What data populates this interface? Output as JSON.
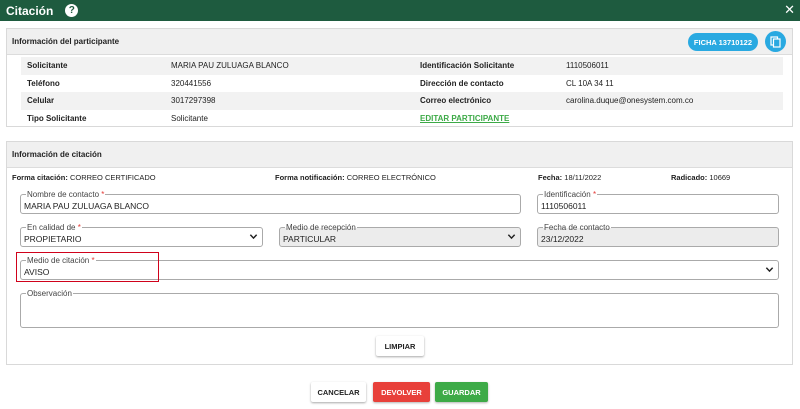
{
  "window": {
    "title": "Citación",
    "help_icon": "?",
    "close_icon": "✕"
  },
  "participant": {
    "header": "Información del participante",
    "ficha_label": "FICHA 13710122",
    "rows": [
      {
        "label1": "Solicitante",
        "value1": "MARIA PAU ZULUAGA BLANCO",
        "label2": "Identificación Solicitante",
        "value2": "1110506011"
      },
      {
        "label1": "Teléfono",
        "value1": "320441556",
        "label2": "Dirección de contacto",
        "value2": "CL 10A 34 11"
      },
      {
        "label1": "Celular",
        "value1": "3017297398",
        "label2": "Correo electrónico",
        "value2": "carolina.duque@onesystem.com.co"
      },
      {
        "label1": "Tipo Solicitante",
        "value1": "Solicitante",
        "label2": "",
        "value2": ""
      }
    ],
    "edit_link": "EDITAR PARTICIPANTE"
  },
  "citation": {
    "header": "Información de citación",
    "forma_citacion_label": "Forma citación:",
    "forma_citacion_value": "CORREO CERTIFICADO",
    "forma_notificacion_label": "Forma notificación:",
    "forma_notificacion_value": "CORREO ELECTRÓNICO",
    "fecha_label": "Fecha:",
    "fecha_value": "18/11/2022",
    "radicado_label": "Radicado:",
    "radicado_value": "10669",
    "fields": {
      "nombre_contacto": {
        "label": "Nombre de contacto",
        "value": "MARIA PAU ZULUAGA BLANCO"
      },
      "identificacion": {
        "label": "Identificación",
        "value": "1110506011"
      },
      "en_calidad_de": {
        "label": "En calidad de",
        "value": "PROPIETARIO"
      },
      "medio_recepcion": {
        "label": "Medio de recepción",
        "value": "PARTICULAR"
      },
      "fecha_contacto": {
        "label": "Fecha de contacto",
        "value": "23/12/2022"
      },
      "medio_citacion": {
        "label": "Medio de citación",
        "value": "AVISO"
      },
      "observacion": {
        "label": "Observación",
        "value": ""
      }
    },
    "required_mark": "*",
    "clear_label": "LIMPIAR"
  },
  "footer": {
    "cancel_label": "CANCELAR",
    "return_label": "DEVOLVER",
    "save_label": "GUARDAR"
  },
  "colors": {
    "titlebar": "#1e5b3f",
    "accent_blue": "#29a9e1",
    "green": "#3daa47",
    "red": "#e8403a",
    "highlight": "#d0021b"
  }
}
